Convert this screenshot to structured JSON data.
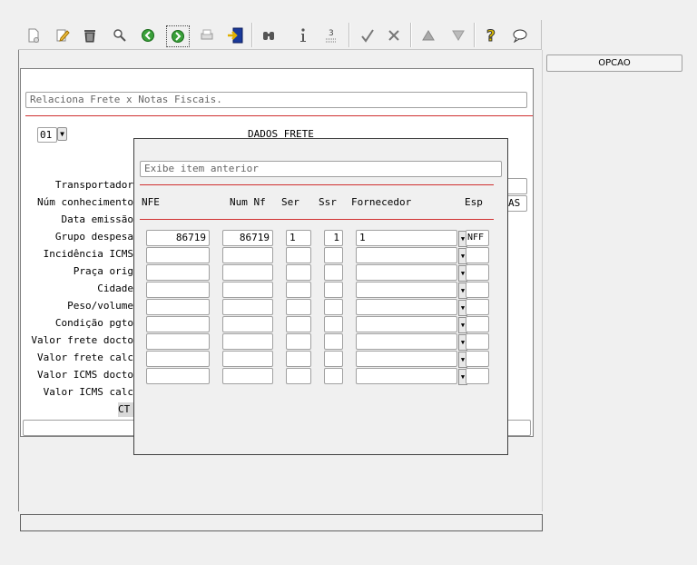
{
  "toolbar": {
    "buttons": [
      {
        "name": "new-icon"
      },
      {
        "name": "edit-icon"
      },
      {
        "name": "delete-icon"
      },
      {
        "name": "search-icon"
      },
      {
        "name": "previous-icon"
      },
      {
        "name": "next-icon"
      },
      {
        "name": "print-icon"
      },
      {
        "name": "exit-icon"
      },
      {
        "name": "binoculars-icon"
      },
      {
        "name": "info-icon"
      },
      {
        "name": "numbered-icon"
      },
      {
        "name": "confirm-icon"
      },
      {
        "name": "cancel-icon"
      },
      {
        "name": "up-icon"
      },
      {
        "name": "down-icon"
      },
      {
        "name": "help-icon"
      },
      {
        "name": "comment-icon"
      }
    ]
  },
  "opcao_button": "OPCAO",
  "form": {
    "description": "Relaciona Frete x Notas Fiscais.",
    "company_code": "01",
    "section_title": "DADOS FRETE",
    "partial_value": "AS",
    "labels": {
      "transportador": "Transportador",
      "num_conhecimento": "Núm conhecimento",
      "data_emissao": "Data emissão",
      "grupo_despesa": "Grupo despesa",
      "incidencia_icms": "Incidência ICMS",
      "praca_orig": "Praça orig",
      "cidade": "Cidade",
      "peso_volume": "Peso/volume",
      "condicao_pgto": "Condição pgto",
      "valor_frete_docto": "Valor frete docto",
      "valor_frete_calc": "Valor frete calc",
      "valor_icms_docto": "Valor ICMS docto",
      "valor_icms_calc": "Valor ICMS calc",
      "ct": "CT"
    }
  },
  "modal": {
    "hint": "Exibe item anterior",
    "columns": {
      "nfe": "NFE",
      "num_nf": "Num Nf",
      "ser": "Ser",
      "ssr": "Ssr",
      "fornecedor": "Fornecedor",
      "esp": "Esp"
    },
    "rows": [
      {
        "nfe": "86719",
        "num_nf": "86719",
        "ser": "1",
        "ssr": "1",
        "fornecedor": "1",
        "esp": "NFF"
      },
      {
        "nfe": "",
        "num_nf": "",
        "ser": "",
        "ssr": "",
        "fornecedor": "",
        "esp": ""
      },
      {
        "nfe": "",
        "num_nf": "",
        "ser": "",
        "ssr": "",
        "fornecedor": "",
        "esp": ""
      },
      {
        "nfe": "",
        "num_nf": "",
        "ser": "",
        "ssr": "",
        "fornecedor": "",
        "esp": ""
      },
      {
        "nfe": "",
        "num_nf": "",
        "ser": "",
        "ssr": "",
        "fornecedor": "",
        "esp": ""
      },
      {
        "nfe": "",
        "num_nf": "",
        "ser": "",
        "ssr": "",
        "fornecedor": "",
        "esp": ""
      },
      {
        "nfe": "",
        "num_nf": "",
        "ser": "",
        "ssr": "",
        "fornecedor": "",
        "esp": ""
      },
      {
        "nfe": "",
        "num_nf": "",
        "ser": "",
        "ssr": "",
        "fornecedor": "",
        "esp": ""
      },
      {
        "nfe": "",
        "num_nf": "",
        "ser": "",
        "ssr": "",
        "fornecedor": "",
        "esp": ""
      }
    ]
  },
  "colors": {
    "red_line": "#d03030",
    "modal_border": "#404040"
  }
}
